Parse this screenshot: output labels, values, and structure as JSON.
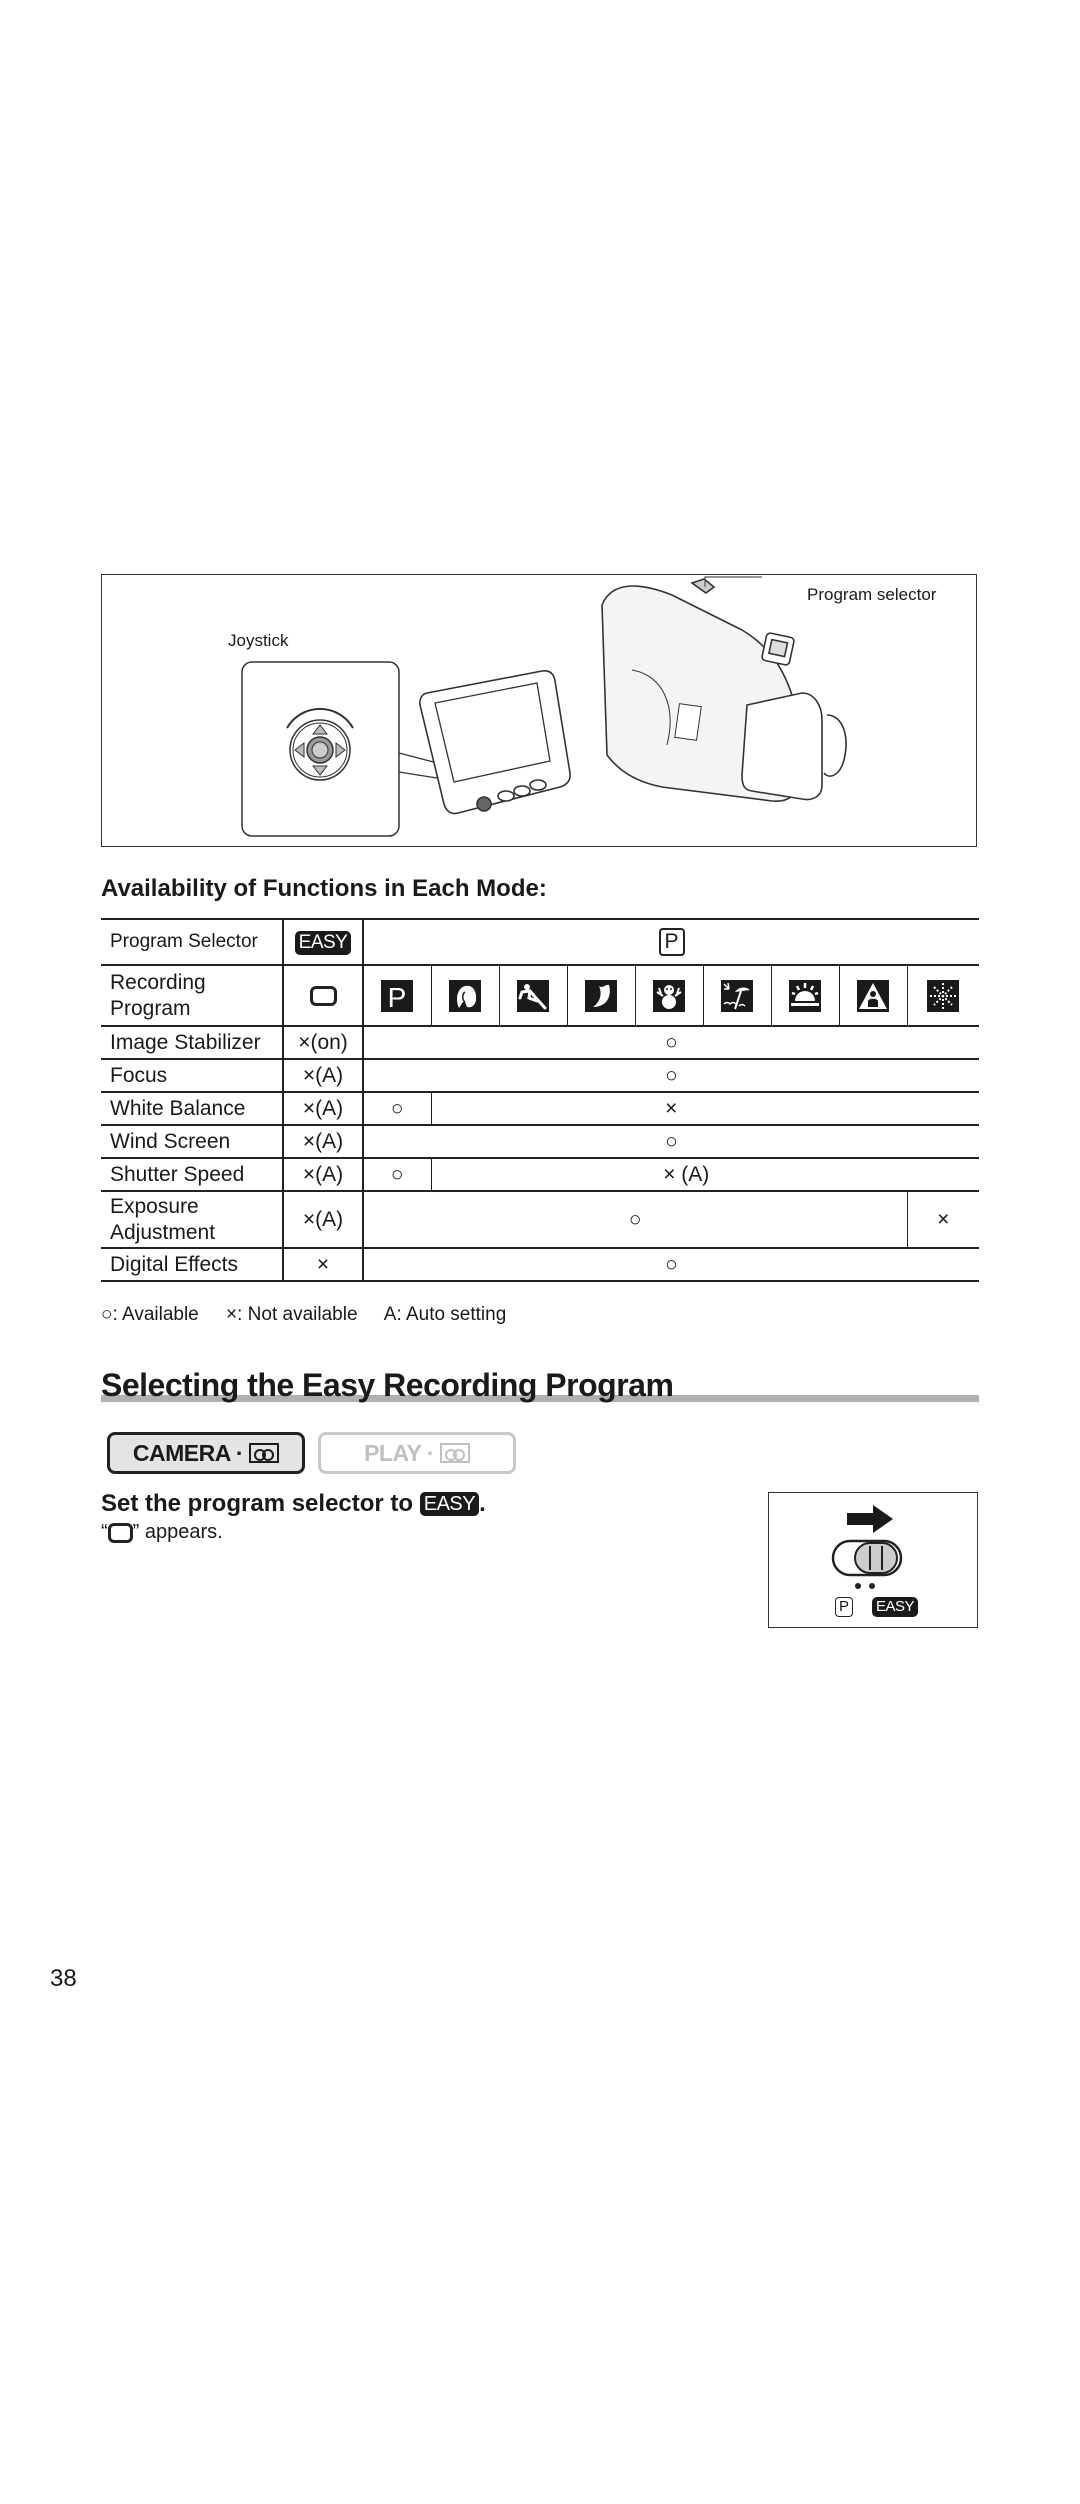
{
  "illustration": {
    "callouts": {
      "joystick": "Joystick",
      "program_selector": "Program selector"
    }
  },
  "availability": {
    "title": "Availability of Functions in Each Mode:",
    "header_rows": {
      "program_selector_label": "Program Selector",
      "easy_badge": "EASY",
      "p_badge": "P",
      "recording_program_label_line1": "Recording",
      "recording_program_label_line2": "Program",
      "easy_program_icon": "rounded-rect-icon",
      "program_icons": [
        {
          "name": "p-program-icon",
          "glyph": "P"
        },
        {
          "name": "portrait-icon"
        },
        {
          "name": "sports-icon"
        },
        {
          "name": "night-icon"
        },
        {
          "name": "snow-icon"
        },
        {
          "name": "beach-icon"
        },
        {
          "name": "sunset-icon"
        },
        {
          "name": "spotlight-icon"
        },
        {
          "name": "fireworks-icon"
        }
      ]
    },
    "rows": [
      {
        "label": "Image Stabilizer",
        "easy": "×(on)",
        "cells": [
          {
            "span": "all",
            "value": "○"
          }
        ]
      },
      {
        "label": "Focus",
        "easy": "×(A)",
        "cells": [
          {
            "span": "all",
            "value": "○"
          }
        ]
      },
      {
        "label": "White Balance",
        "easy": "×(A)",
        "cells": [
          {
            "span": "P",
            "value": "○"
          },
          {
            "span": "rest",
            "value": "×"
          }
        ]
      },
      {
        "label": "Wind Screen",
        "easy": "×(A)",
        "cells": [
          {
            "span": "all",
            "value": "○"
          }
        ]
      },
      {
        "label": "Shutter Speed",
        "easy": "×(A)",
        "cells": [
          {
            "span": "P",
            "value": "○"
          },
          {
            "span": "rest",
            "value": "× (A)"
          }
        ]
      },
      {
        "label_line1": "Exposure",
        "label_line2": "Adjustment",
        "easy": "×(A)",
        "cells": [
          {
            "span": "all-but-last",
            "value": "○"
          },
          {
            "span": "last",
            "value": "×"
          }
        ]
      },
      {
        "label": "Digital Effects",
        "easy": "×",
        "cells": [
          {
            "span": "all",
            "value": "○"
          }
        ]
      }
    ],
    "legend": {
      "available": "○: Available",
      "not_available": "×: Not available",
      "auto": "A: Auto setting"
    }
  },
  "section": {
    "title": "Selecting the Easy Recording Program",
    "mode_buttons": {
      "camera": "CAMERA ·",
      "play": "PLAY ·"
    },
    "step_text": "Set the program selector to",
    "step_badge": "EASY",
    "step_end": ".",
    "note_open": "“",
    "note_close": "” appears.",
    "selector_figure": {
      "p_label": "P",
      "easy_label": "EASY"
    }
  },
  "page_number": "38"
}
